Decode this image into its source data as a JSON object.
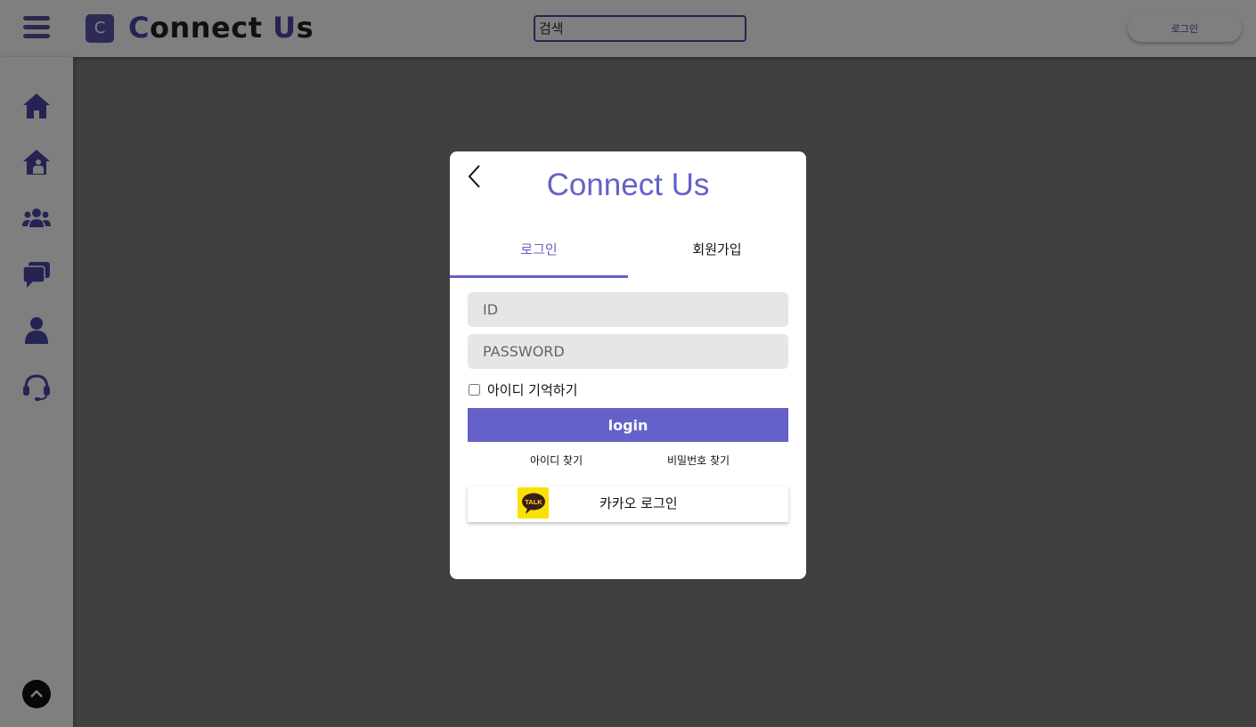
{
  "header": {
    "brand_first": "C",
    "brand_mid": "onnect ",
    "brand_u": "U",
    "brand_end": "s",
    "logo_letter": "C",
    "search_placeholder": "검색",
    "login_label": "로그인"
  },
  "sidebar": {
    "icons": [
      "home-icon",
      "house-person-icon",
      "users-icon",
      "chat-icon",
      "user-icon",
      "headset-icon"
    ],
    "scroll_top_icon": "chevron-up-icon"
  },
  "modal": {
    "title": "Connect Us",
    "tabs": [
      {
        "label": "로그인",
        "active": true
      },
      {
        "label": "회원가입",
        "active": false
      }
    ],
    "id_placeholder": "ID",
    "password_placeholder": "PASSWORD",
    "remember_label": "아이디 기억하기",
    "login_button": "login",
    "find_id": "아이디 찾기",
    "find_password": "비밀번호 찾기",
    "kakao_badge": "TALK",
    "kakao_label": "카카오 로그인"
  },
  "colors": {
    "accent": "#6461c9",
    "brand_dark": "#4a46a8",
    "kakao_yellow": "#fae100"
  }
}
